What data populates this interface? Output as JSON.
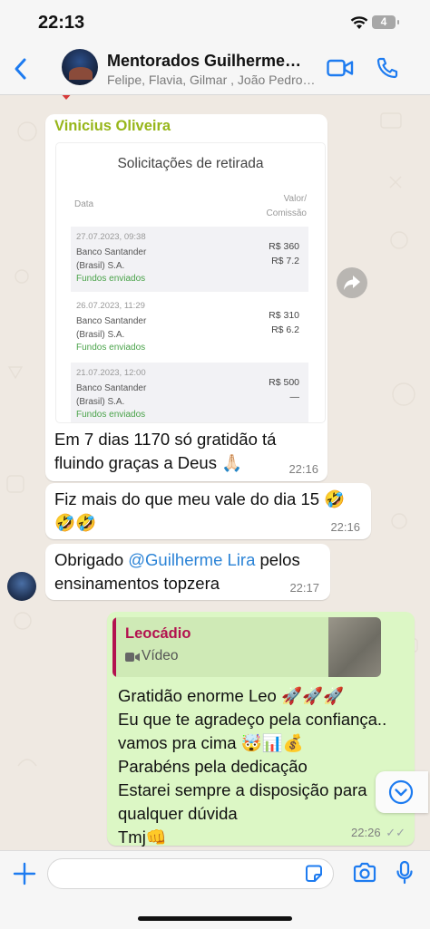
{
  "status_bar": {
    "time": "22:13",
    "battery": "4"
  },
  "header": {
    "title": "Mentorados Guilherme…",
    "members": "Felipe, Flavia, Gilmar , João Pedro…"
  },
  "messages": {
    "m1": {
      "sender": "Vinicius Oliveira",
      "screenshot": {
        "title": "Solicitações de retirada",
        "col_date": "Data",
        "col_value_1": "Valor/",
        "col_value_2": "Comissão",
        "rows": [
          {
            "date": "27.07.2023, 09:38",
            "bank_1": "Banco Santander",
            "bank_2": "(Brasil) S.A.",
            "status": "Fundos enviados",
            "value": "R$ 360",
            "commission": "R$ 7.2"
          },
          {
            "date": "26.07.2023, 11:29",
            "bank_1": "Banco Santander",
            "bank_2": "(Brasil) S.A.",
            "status": "Fundos enviados",
            "value": "R$ 310",
            "commission": "R$ 6.2"
          },
          {
            "date": "21.07.2023, 12:00",
            "bank_1": "Banco Santander",
            "bank_2": "(Brasil) S.A.",
            "status": "Fundos enviados",
            "value": "R$ 500",
            "commission": "—"
          }
        ]
      },
      "text_line1": "Em 7 dias 1170 só gratidão tá",
      "text_line2": "fluindo graças a Deus 🙏🏻",
      "time": "22:16"
    },
    "m2": {
      "text_line1": "Fiz mais do que meu vale do dia 15 🤣",
      "text_line2": "🤣🤣",
      "time": "22:16"
    },
    "m3": {
      "text_prefix": "Obrigado ",
      "mention": "@Guilherme Lira",
      "text_suffix": " pelos",
      "text_line2": "ensinamentos topzera",
      "time": "22:17"
    },
    "m4": {
      "quote_name": "Leocádio",
      "quote_type": "Vídeo",
      "lines": [
        "Gratidão enorme Leo 🚀🚀🚀",
        "Eu que te agradeço pela confiança..",
        "vamos pra cima 🤯📊💰",
        "Parabéns pela dedicação",
        "Estarei sempre a disposição para",
        "qualquer dúvida",
        "Tmj👊"
      ],
      "time": "22:26",
      "ticks": "✓✓"
    }
  },
  "input": {
    "placeholder": ""
  },
  "colors": {
    "accent": "#1d7bf0",
    "sender_name": "#97b61a",
    "quote_name": "#b3124f",
    "mention": "#2b83d6",
    "outgoing_bubble": "#dcf7c5"
  },
  "icons": [
    "wifi-icon",
    "back-icon",
    "video-call-icon",
    "phone-icon",
    "forward-icon",
    "video-icon",
    "chevron-down-icon",
    "plus-icon",
    "sticker-icon",
    "camera-icon",
    "mic-icon"
  ]
}
